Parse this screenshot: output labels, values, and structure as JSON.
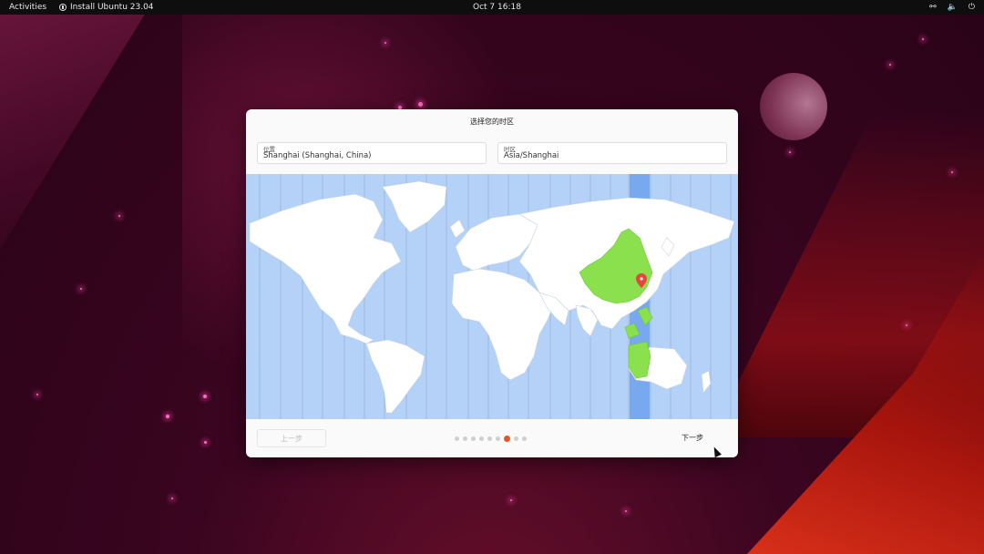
{
  "topbar": {
    "activities_label": "Activities",
    "app_label": "Install Ubuntu 23.04",
    "clock": "Oct 7  16:18",
    "tray_icons": [
      "accessibility-icon",
      "volume-icon",
      "power-icon"
    ]
  },
  "dialog": {
    "title": "选择您的时区",
    "location": {
      "label": "位置",
      "value": "Shanghai (Shanghai, China)"
    },
    "timezone": {
      "label": "时区",
      "value": "Asia/Shanghai"
    },
    "map": {
      "selected_city": "Shanghai",
      "highlight_color": "#8be04e",
      "band_color": "#78a8ee",
      "ocean_color": "#b4d2f8",
      "pin_color": "#e8453c"
    },
    "prev_label": "上一步",
    "next_label": "下一步",
    "progress": {
      "total_steps": 9,
      "current_step": 7,
      "accent": "#e95420"
    }
  }
}
